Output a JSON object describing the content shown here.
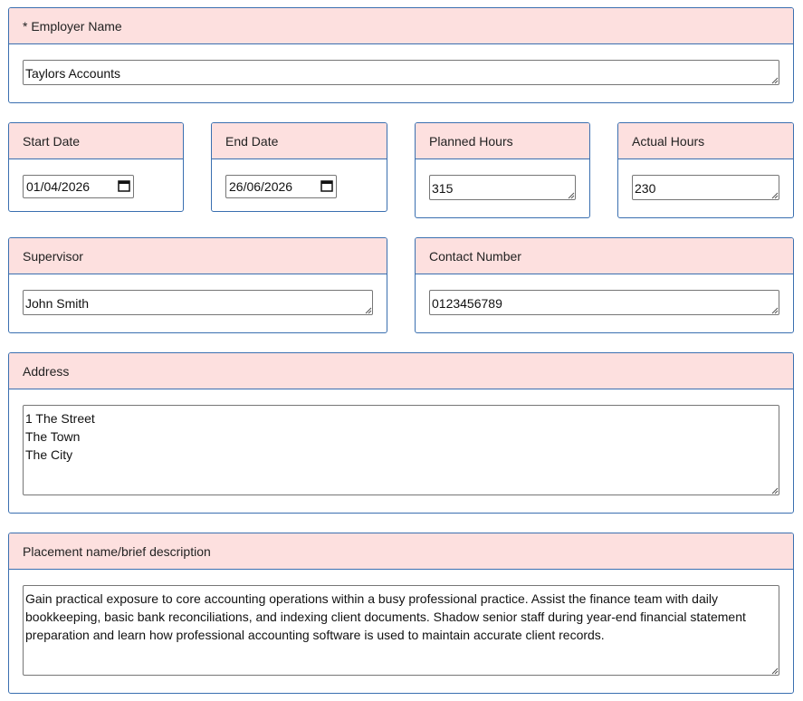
{
  "employer": {
    "label": "* Employer Name",
    "value": "Taylors Accounts"
  },
  "dates": {
    "start_label": "Start Date",
    "start_value": "01/04/2026",
    "end_label": "End Date",
    "end_value": "26/06/2026"
  },
  "hours": {
    "planned_label": "Planned Hours",
    "planned_value": "315",
    "actual_label": "Actual Hours",
    "actual_value": "230"
  },
  "supervisor": {
    "label": "Supervisor",
    "value": "John Smith"
  },
  "contact": {
    "label": "Contact Number",
    "value": "0123456789"
  },
  "address": {
    "label": "Address",
    "value": "1 The Street\nThe Town\nThe City"
  },
  "placement": {
    "label": "Placement name/brief description",
    "value": "Gain practical exposure to core accounting operations within a busy professional practice. Assist the finance team with daily bookkeeping, basic bank reconciliations, and indexing client documents. Shadow senior staff during year-end financial statement preparation and learn how professional accounting software is used to maintain accurate client records."
  },
  "icons": {
    "calendar": "calendar-icon",
    "resize": "resize-grip-icon"
  },
  "colors": {
    "header_bg": "#fde0df",
    "panel_border": "#3a6fb0"
  }
}
